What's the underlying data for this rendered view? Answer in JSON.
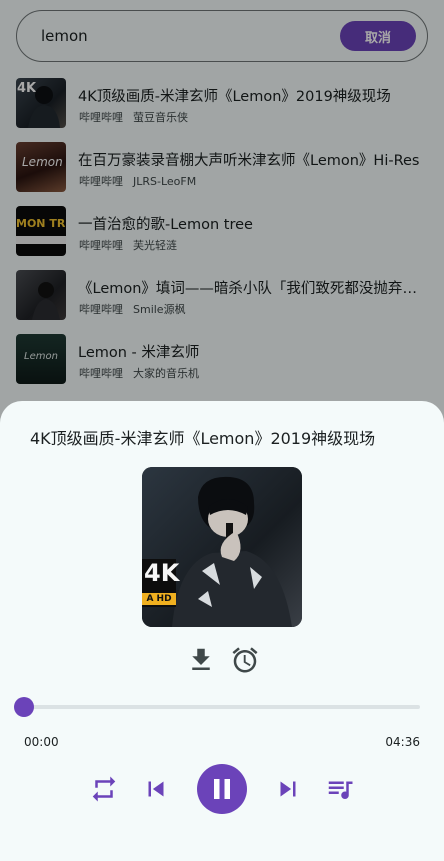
{
  "search": {
    "query": "lemon",
    "cancel_label": "取消"
  },
  "results": [
    {
      "title": "4K顶级画质-米津玄师《Lemon》2019神级现场",
      "source": "哔哩哔哩",
      "uploader": "萤豆音乐侠",
      "thumb_badge": "4K"
    },
    {
      "title": "在百万豪装录音棚大声听米津玄师《Lemon》Hi-Res",
      "source": "哔哩哔哩",
      "uploader": "JLRS-LeoFM",
      "thumb_badge": "Lemon"
    },
    {
      "title": "一首治愈的歌-Lemon tree",
      "source": "哔哩哔哩",
      "uploader": "芙光轻涟",
      "thumb_badge": "MON TR"
    },
    {
      "title": "《Lemon》填词——暗杀小队「我们致死都没抛弃信念」",
      "source": "哔哩哔哩",
      "uploader": "Smile源枫",
      "thumb_badge": ""
    },
    {
      "title": "Lemon - 米津玄师",
      "source": "哔哩哔哩",
      "uploader": "大家的音乐机",
      "thumb_badge": "Lemon"
    }
  ],
  "player": {
    "title": "4K顶级画质-米津玄师《Lemon》2019神级现场",
    "elapsed": "00:00",
    "duration": "04:36",
    "progress": 0,
    "cover_badge": "4K",
    "cover_badge_sub": "A HD"
  },
  "colors": {
    "accent": "#6b43b9",
    "background": "#f4fafa",
    "text": "#1b2021",
    "track": "#dbe2e4"
  },
  "icons": {
    "download": "download-icon",
    "timer": "alarm-icon",
    "repeat": "repeat-icon",
    "previous": "skip-previous-icon",
    "pause": "pause-icon",
    "next": "skip-next-icon",
    "queue": "queue-music-icon"
  }
}
